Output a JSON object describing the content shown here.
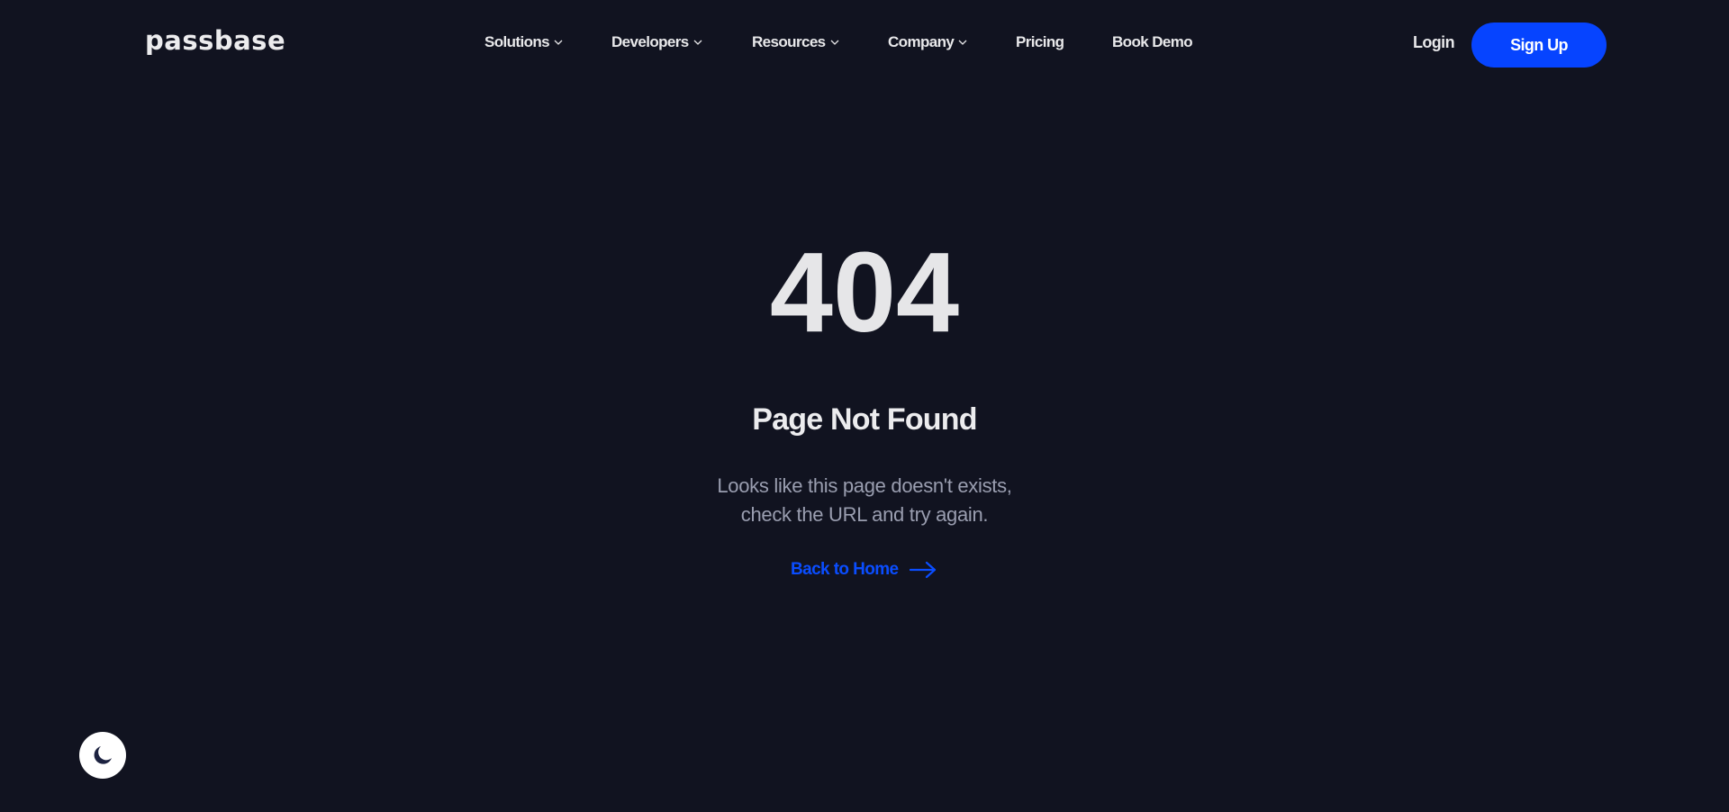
{
  "header": {
    "logo": "passbase",
    "nav": [
      {
        "label": "Solutions",
        "dropdown": true
      },
      {
        "label": "Developers",
        "dropdown": true
      },
      {
        "label": "Resources",
        "dropdown": true
      },
      {
        "label": "Company",
        "dropdown": true
      },
      {
        "label": "Pricing",
        "dropdown": false
      },
      {
        "label": "Book Demo",
        "dropdown": false
      }
    ],
    "login_label": "Login",
    "signup_label": "Sign Up"
  },
  "error": {
    "code": "404",
    "title": "Page Not Found",
    "description_line1": "Looks like this page doesn't exists,",
    "description_line2": "check the URL and try again.",
    "back_link": "Back to Home",
    "back_icon": "arrow-right-icon"
  },
  "theme_toggle": {
    "icon": "moon-icon"
  },
  "colors": {
    "background": "#111320",
    "accent": "#0644ff",
    "text": "#e8e8ea",
    "muted": "#9a9eb0"
  }
}
